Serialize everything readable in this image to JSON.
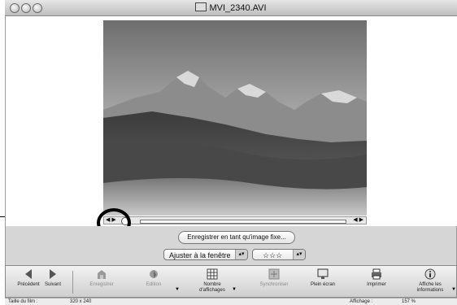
{
  "window": {
    "title": "MVI_2340.AVI"
  },
  "scrubber": {
    "left_glyph": "◀ ▶",
    "right_glyph": "◀ ▶"
  },
  "controls": {
    "save_still_label": "Enregistrer en tant qu'image fixe...",
    "fit_select_value": "Ajuster à la fenêtre",
    "rating_value": "☆☆☆"
  },
  "toolbar": {
    "prev_label": "Précédent",
    "next_label": "Suivant",
    "save_label": "Enregistrer",
    "edit_label": "Edition",
    "views_label": "Nombre d'affichages",
    "sync_label": "Synchroniser",
    "fullscreen_label": "Plein écran",
    "print_label": "Imprimer",
    "info_label": "Affiche les informations"
  },
  "status": {
    "size_label": "Taille du film :",
    "size_value": "320 x 240",
    "zoom_label": "Affichage :",
    "zoom_value": "157 %"
  }
}
